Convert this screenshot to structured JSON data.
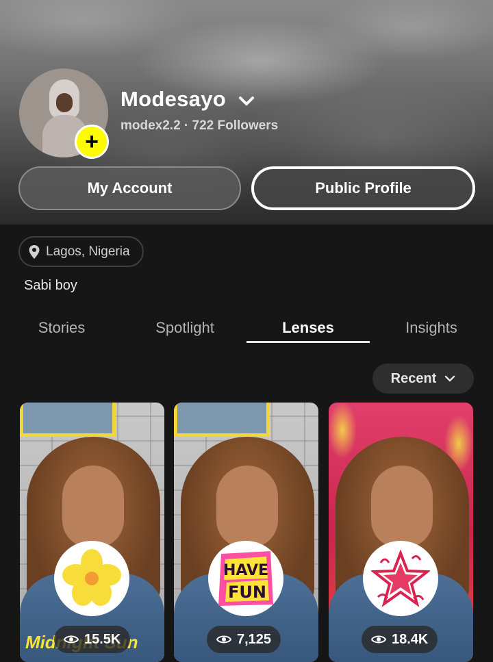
{
  "profile": {
    "display_name": "Modesayo",
    "username_line": "modex2.2 · 722 Followers",
    "add_symbol": "+"
  },
  "buttons": {
    "my_account": "My Account",
    "public_profile": "Public Profile"
  },
  "location": "Lagos, Nigeria",
  "bio": "Sabi boy",
  "tabs": [
    {
      "label": "Stories",
      "active": false
    },
    {
      "label": "Spotlight",
      "active": false
    },
    {
      "label": "Lenses",
      "active": true
    },
    {
      "label": "Insights",
      "active": false
    }
  ],
  "sort": {
    "label": "Recent"
  },
  "lenses": [
    {
      "icon": "hibiscus-flower-icon",
      "views": "15.5K",
      "caption": "Midnight Sun"
    },
    {
      "icon": "have-fun-icon",
      "views": "7,125"
    },
    {
      "icon": "pink-star-icon",
      "views": "18.4K"
    }
  ],
  "colors": {
    "accent_yellow": "#fffc00",
    "background": "#161616"
  }
}
